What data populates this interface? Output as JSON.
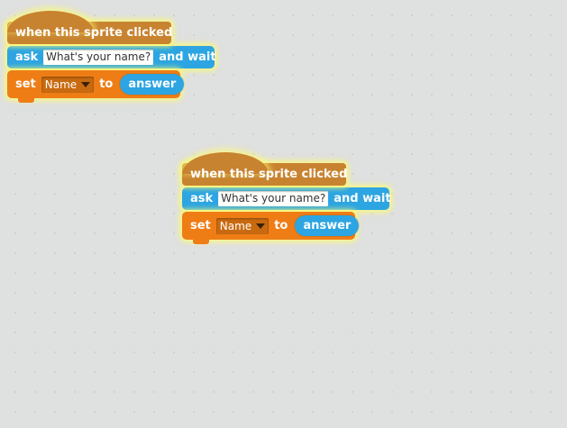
{
  "scripts": [
    {
      "hat_label": "when this sprite clicked",
      "ask_label": "ask",
      "ask_input": "What's your name?",
      "ask_suffix": "and wait",
      "set_label": "set",
      "set_variable": "Name",
      "set_to": "to",
      "set_value": "answer"
    },
    {
      "hat_label": "when this sprite clicked",
      "ask_label": "ask",
      "ask_input": "What's your name?",
      "ask_suffix": "and wait",
      "set_label": "set",
      "set_variable": "Name",
      "set_to": "to",
      "set_value": "answer"
    }
  ],
  "colors": {
    "events": "#c88330",
    "sensing": "#2ca5e2",
    "data": "#ee7d16",
    "glow": "#fffc6e",
    "canvas": "#dfe0e0"
  },
  "icons": {
    "dropdown": "triangle-down-icon"
  }
}
